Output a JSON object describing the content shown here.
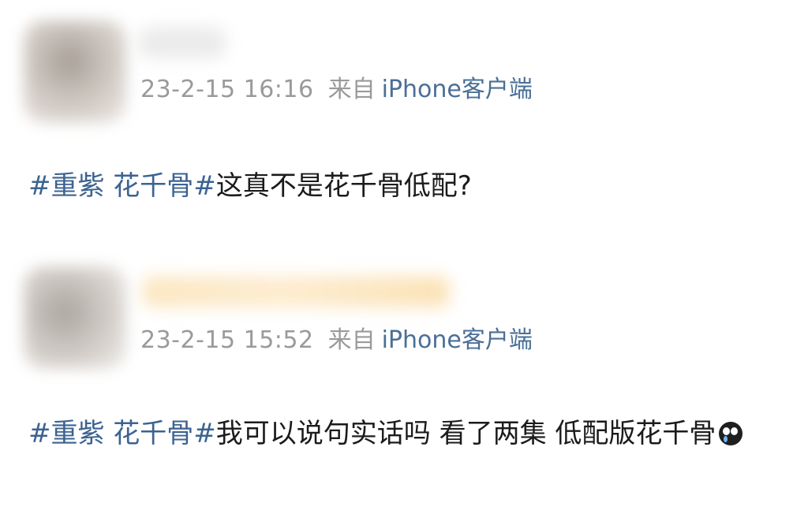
{
  "posts": [
    {
      "timestamp": "23-2-15 16:16",
      "source_prefix": "来自",
      "source_client": "iPhone客户端",
      "topic": "#重紫 花千骨#",
      "text": "这真不是花千骨低配?"
    },
    {
      "timestamp": "23-2-15 15:52",
      "source_prefix": "来自",
      "source_client": "iPhone客户端",
      "topic": "#重紫 花千骨#",
      "text": "我可以说句实话吗 看了两集 低配版花千骨",
      "emoji": "crying-face-icon"
    }
  ],
  "colors": {
    "topic": "#3b6391",
    "client": "#4a6f97",
    "meta": "#9a9a9a",
    "text": "#1b1b1b"
  }
}
